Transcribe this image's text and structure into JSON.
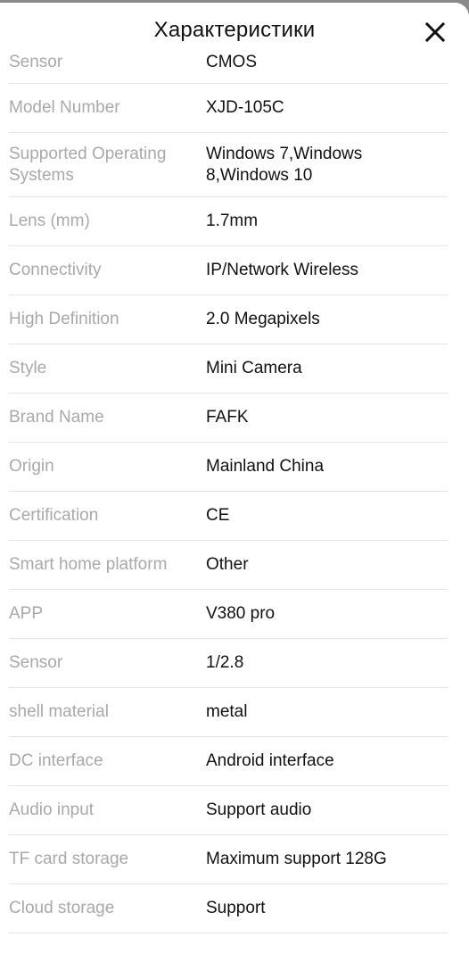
{
  "header": {
    "title": "Характеристики",
    "close_icon": "close-x-icon"
  },
  "specs": [
    {
      "label": "Sensor",
      "value": "CMOS"
    },
    {
      "label": "Model Number",
      "value": "XJD-105C"
    },
    {
      "label": "Supported Operating Systems",
      "value": "Windows 7,Windows 8,Windows 10"
    },
    {
      "label": "Lens (mm)",
      "value": "1.7mm"
    },
    {
      "label": "Connectivity",
      "value": "IP/Network Wireless"
    },
    {
      "label": "High Definition",
      "value": "2.0 Megapixels"
    },
    {
      "label": "Style",
      "value": "Mini Camera"
    },
    {
      "label": "Brand Name",
      "value": "FAFK"
    },
    {
      "label": "Origin",
      "value": "Mainland China"
    },
    {
      "label": "Certification",
      "value": "CE"
    },
    {
      "label": "Smart home platform",
      "value": "Other"
    },
    {
      "label": "APP",
      "value": "V380 pro"
    },
    {
      "label": "Sensor",
      "value": "1/2.8"
    },
    {
      "label": "shell material",
      "value": "metal"
    },
    {
      "label": "DC interface",
      "value": "Android interface"
    },
    {
      "label": "Audio input",
      "value": "Support audio"
    },
    {
      "label": "TF card storage",
      "value": "Maximum support 128G"
    },
    {
      "label": "Cloud storage",
      "value": "Support"
    }
  ]
}
